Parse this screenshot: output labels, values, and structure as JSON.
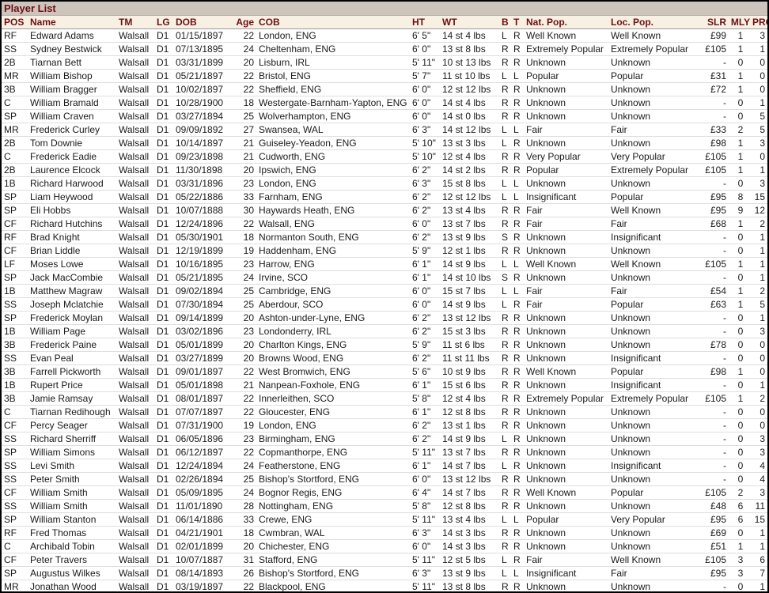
{
  "title": "Player List",
  "columns": [
    "POS",
    "Name",
    "TM",
    "LG",
    "DOB",
    "Age",
    "COB",
    "HT",
    "WT",
    "B",
    "T",
    "Nat. Pop.",
    "Loc. Pop.",
    "SLR",
    "MLY",
    "PROY"
  ],
  "colors": {
    "title_bg": "#cdc5bc",
    "header_bg": "#f8f0e3",
    "header_text": "#6b0f14",
    "row_separator": "#dedede"
  },
  "rows": [
    [
      "RF",
      "Edward Adams",
      "Walsall",
      "D1",
      "01/15/1897",
      "22",
      "London, ENG",
      "6' 5\"",
      "14 st 4 lbs",
      "L",
      "R",
      "Well Known",
      "Well Known",
      "£99",
      "1",
      "3"
    ],
    [
      "SS",
      "Sydney Bestwick",
      "Walsall",
      "D1",
      "07/13/1895",
      "24",
      "Cheltenham, ENG",
      "6' 0\"",
      "13 st 8 lbs",
      "R",
      "R",
      "Extremely Popular",
      "Extremely Popular",
      "£105",
      "1",
      "1"
    ],
    [
      "2B",
      "Tiarnan Bett",
      "Walsall",
      "D1",
      "03/31/1899",
      "20",
      "Lisburn, IRL",
      "5' 11\"",
      "10 st 13 lbs",
      "R",
      "R",
      "Unknown",
      "Unknown",
      "-",
      "0",
      "0"
    ],
    [
      "MR",
      "William Bishop",
      "Walsall",
      "D1",
      "05/21/1897",
      "22",
      "Bristol, ENG",
      "5' 7\"",
      "11 st 10 lbs",
      "L",
      "L",
      "Popular",
      "Popular",
      "£31",
      "1",
      "0"
    ],
    [
      "3B",
      "William Bragger",
      "Walsall",
      "D1",
      "10/02/1897",
      "22",
      "Sheffield, ENG",
      "6' 0\"",
      "12 st 12 lbs",
      "R",
      "R",
      "Unknown",
      "Unknown",
      "£72",
      "1",
      "0"
    ],
    [
      "C",
      "William Bramald",
      "Walsall",
      "D1",
      "10/28/1900",
      "18",
      "Westergate-Barnham-Yapton, ENG",
      "6' 0\"",
      "14 st 4 lbs",
      "R",
      "R",
      "Unknown",
      "Unknown",
      "-",
      "0",
      "1"
    ],
    [
      "SP",
      "William Craven",
      "Walsall",
      "D1",
      "03/27/1894",
      "25",
      "Wolverhampton, ENG",
      "6' 0\"",
      "14 st 0 lbs",
      "R",
      "R",
      "Unknown",
      "Unknown",
      "-",
      "0",
      "5"
    ],
    [
      "MR",
      "Frederick Curley",
      "Walsall",
      "D1",
      "09/09/1892",
      "27",
      "Swansea, WAL",
      "6' 3\"",
      "14 st 12 lbs",
      "L",
      "L",
      "Fair",
      "Fair",
      "£33",
      "2",
      "5"
    ],
    [
      "2B",
      "Tom Downie",
      "Walsall",
      "D1",
      "10/14/1897",
      "21",
      "Guiseley-Yeadon, ENG",
      "5' 10\"",
      "13 st 3 lbs",
      "L",
      "R",
      "Unknown",
      "Unknown",
      "£98",
      "1",
      "3"
    ],
    [
      "C",
      "Frederick Eadie",
      "Walsall",
      "D1",
      "09/23/1898",
      "21",
      "Cudworth, ENG",
      "5' 10\"",
      "12 st 4 lbs",
      "R",
      "R",
      "Very Popular",
      "Very Popular",
      "£105",
      "1",
      "0"
    ],
    [
      "2B",
      "Laurence Elcock",
      "Walsall",
      "D1",
      "11/30/1898",
      "20",
      "Ipswich, ENG",
      "6' 2\"",
      "14 st 2 lbs",
      "R",
      "R",
      "Popular",
      "Extremely Popular",
      "£105",
      "1",
      "1"
    ],
    [
      "1B",
      "Richard Harwood",
      "Walsall",
      "D1",
      "03/31/1896",
      "23",
      "London, ENG",
      "6' 3\"",
      "15 st 8 lbs",
      "L",
      "L",
      "Unknown",
      "Unknown",
      "-",
      "0",
      "3"
    ],
    [
      "SP",
      "Liam Heywood",
      "Walsall",
      "D1",
      "05/22/1886",
      "33",
      "Farnham, ENG",
      "6' 2\"",
      "12 st 12 lbs",
      "L",
      "L",
      "Insignificant",
      "Popular",
      "£95",
      "8",
      "15"
    ],
    [
      "SP",
      "Eli Hobbs",
      "Walsall",
      "D1",
      "10/07/1888",
      "30",
      "Haywards Heath, ENG",
      "6' 2\"",
      "13 st 4 lbs",
      "R",
      "R",
      "Fair",
      "Well Known",
      "£95",
      "9",
      "12"
    ],
    [
      "CF",
      "Richard Hutchins",
      "Walsall",
      "D1",
      "12/24/1896",
      "22",
      "Walsall, ENG",
      "6' 0\"",
      "13 st 7 lbs",
      "R",
      "R",
      "Fair",
      "Fair",
      "£68",
      "1",
      "2"
    ],
    [
      "RF",
      "Brad Knight",
      "Walsall",
      "D1",
      "05/30/1901",
      "18",
      "Normanton South, ENG",
      "6' 2\"",
      "13 st 9 lbs",
      "S",
      "R",
      "Unknown",
      "Insignificant",
      "-",
      "0",
      "1"
    ],
    [
      "CF",
      "Brian Liddle",
      "Walsall",
      "D1",
      "12/19/1899",
      "19",
      "Haddenham, ENG",
      "5' 9\"",
      "12 st 1 lbs",
      "R",
      "R",
      "Unknown",
      "Unknown",
      "-",
      "0",
      "1"
    ],
    [
      "LF",
      "Moses Lowe",
      "Walsall",
      "D1",
      "10/16/1895",
      "23",
      "Harrow, ENG",
      "6' 1\"",
      "14 st 9 lbs",
      "L",
      "L",
      "Well Known",
      "Well Known",
      "£105",
      "1",
      "1"
    ],
    [
      "SP",
      "Jack MacCombie",
      "Walsall",
      "D1",
      "05/21/1895",
      "24",
      "Irvine, SCO",
      "6' 1\"",
      "14 st 10 lbs",
      "S",
      "R",
      "Unknown",
      "Unknown",
      "-",
      "0",
      "1"
    ],
    [
      "1B",
      "Matthew Magraw",
      "Walsall",
      "D1",
      "09/02/1894",
      "25",
      "Cambridge, ENG",
      "6' 0\"",
      "15 st 7 lbs",
      "L",
      "L",
      "Fair",
      "Fair",
      "£54",
      "1",
      "2"
    ],
    [
      "SS",
      "Joseph Mclatchie",
      "Walsall",
      "D1",
      "07/30/1894",
      "25",
      "Aberdour, SCO",
      "6' 0\"",
      "14 st 9 lbs",
      "L",
      "R",
      "Fair",
      "Popular",
      "£63",
      "1",
      "5"
    ],
    [
      "SP",
      "Frederick Moylan",
      "Walsall",
      "D1",
      "09/14/1899",
      "20",
      "Ashton-under-Lyne, ENG",
      "6' 2\"",
      "13 st 12 lbs",
      "R",
      "R",
      "Unknown",
      "Unknown",
      "-",
      "0",
      "1"
    ],
    [
      "1B",
      "William Page",
      "Walsall",
      "D1",
      "03/02/1896",
      "23",
      "Londonderry, IRL",
      "6' 2\"",
      "15 st 3 lbs",
      "R",
      "R",
      "Unknown",
      "Unknown",
      "-",
      "0",
      "3"
    ],
    [
      "3B",
      "Frederick Paine",
      "Walsall",
      "D1",
      "05/01/1899",
      "20",
      "Charlton Kings, ENG",
      "5' 9\"",
      "11 st 6 lbs",
      "R",
      "R",
      "Unknown",
      "Unknown",
      "£78",
      "0",
      "0"
    ],
    [
      "SS",
      "Evan Peal",
      "Walsall",
      "D1",
      "03/27/1899",
      "20",
      "Browns Wood, ENG",
      "6' 2\"",
      "11 st 11 lbs",
      "R",
      "R",
      "Unknown",
      "Insignificant",
      "-",
      "0",
      "0"
    ],
    [
      "3B",
      "Farrell Pickworth",
      "Walsall",
      "D1",
      "09/01/1897",
      "22",
      "West Bromwich, ENG",
      "5' 6\"",
      "10 st 9 lbs",
      "R",
      "R",
      "Well Known",
      "Popular",
      "£98",
      "1",
      "0"
    ],
    [
      "1B",
      "Rupert Price",
      "Walsall",
      "D1",
      "05/01/1898",
      "21",
      "Nanpean-Foxhole, ENG",
      "6' 1\"",
      "15 st 6 lbs",
      "R",
      "R",
      "Unknown",
      "Insignificant",
      "-",
      "0",
      "1"
    ],
    [
      "3B",
      "Jamie Ramsay",
      "Walsall",
      "D1",
      "08/01/1897",
      "22",
      "Innerleithen, SCO",
      "5' 8\"",
      "12 st 4 lbs",
      "R",
      "R",
      "Extremely Popular",
      "Extremely Popular",
      "£105",
      "1",
      "2"
    ],
    [
      "C",
      "Tiarnan Redihough",
      "Walsall",
      "D1",
      "07/07/1897",
      "22",
      "Gloucester, ENG",
      "6' 1\"",
      "12 st 8 lbs",
      "R",
      "R",
      "Unknown",
      "Unknown",
      "-",
      "0",
      "0"
    ],
    [
      "CF",
      "Percy Seager",
      "Walsall",
      "D1",
      "07/31/1900",
      "19",
      "London, ENG",
      "6' 2\"",
      "13 st 1 lbs",
      "R",
      "R",
      "Unknown",
      "Unknown",
      "-",
      "0",
      "0"
    ],
    [
      "SS",
      "Richard Sherriff",
      "Walsall",
      "D1",
      "06/05/1896",
      "23",
      "Birmingham, ENG",
      "6' 2\"",
      "14 st 9 lbs",
      "L",
      "R",
      "Unknown",
      "Unknown",
      "-",
      "0",
      "3"
    ],
    [
      "SP",
      "William Simons",
      "Walsall",
      "D1",
      "06/12/1897",
      "22",
      "Copmanthorpe, ENG",
      "5' 11\"",
      "13 st 7 lbs",
      "R",
      "R",
      "Unknown",
      "Unknown",
      "-",
      "0",
      "3"
    ],
    [
      "SS",
      "Levi Smith",
      "Walsall",
      "D1",
      "12/24/1894",
      "24",
      "Featherstone, ENG",
      "6' 1\"",
      "14 st 7 lbs",
      "L",
      "R",
      "Unknown",
      "Insignificant",
      "-",
      "0",
      "4"
    ],
    [
      "SS",
      "Peter Smith",
      "Walsall",
      "D1",
      "02/26/1894",
      "25",
      "Bishop's Stortford, ENG",
      "6' 0\"",
      "13 st 12 lbs",
      "R",
      "R",
      "Unknown",
      "Unknown",
      "-",
      "0",
      "4"
    ],
    [
      "CF",
      "William Smith",
      "Walsall",
      "D1",
      "05/09/1895",
      "24",
      "Bognor Regis, ENG",
      "6' 4\"",
      "14 st 7 lbs",
      "R",
      "R",
      "Well Known",
      "Popular",
      "£105",
      "2",
      "3"
    ],
    [
      "SS",
      "William Smith",
      "Walsall",
      "D1",
      "11/01/1890",
      "28",
      "Nottingham, ENG",
      "5' 8\"",
      "12 st 8 lbs",
      "R",
      "R",
      "Unknown",
      "Unknown",
      "£48",
      "6",
      "11"
    ],
    [
      "SP",
      "William Stanton",
      "Walsall",
      "D1",
      "06/14/1886",
      "33",
      "Crewe, ENG",
      "5' 11\"",
      "13 st 4 lbs",
      "L",
      "L",
      "Popular",
      "Very Popular",
      "£95",
      "6",
      "15"
    ],
    [
      "RF",
      "Fred Thomas",
      "Walsall",
      "D1",
      "04/21/1901",
      "18",
      "Cwmbran, WAL",
      "6' 3\"",
      "14 st 3 lbs",
      "R",
      "R",
      "Unknown",
      "Unknown",
      "£69",
      "0",
      "1"
    ],
    [
      "C",
      "Archibald Tobin",
      "Walsall",
      "D1",
      "02/01/1899",
      "20",
      "Chichester, ENG",
      "6' 0\"",
      "14 st 3 lbs",
      "R",
      "R",
      "Unknown",
      "Unknown",
      "£51",
      "1",
      "1"
    ],
    [
      "CF",
      "Peter Travers",
      "Walsall",
      "D1",
      "10/07/1887",
      "31",
      "Stafford, ENG",
      "5' 11\"",
      "12 st 5 lbs",
      "L",
      "R",
      "Fair",
      "Well Known",
      "£105",
      "3",
      "6"
    ],
    [
      "SP",
      "Augustus Wilkes",
      "Walsall",
      "D1",
      "08/14/1893",
      "26",
      "Bishop's Stortford, ENG",
      "6' 3\"",
      "13 st 9 lbs",
      "L",
      "L",
      "Insignificant",
      "Fair",
      "£95",
      "3",
      "7"
    ],
    [
      "MR",
      "Jonathan Wood",
      "Walsall",
      "D1",
      "03/19/1897",
      "22",
      "Blackpool, ENG",
      "5' 11\"",
      "13 st 8 lbs",
      "R",
      "R",
      "Unknown",
      "Unknown",
      "-",
      "0",
      "1"
    ]
  ]
}
